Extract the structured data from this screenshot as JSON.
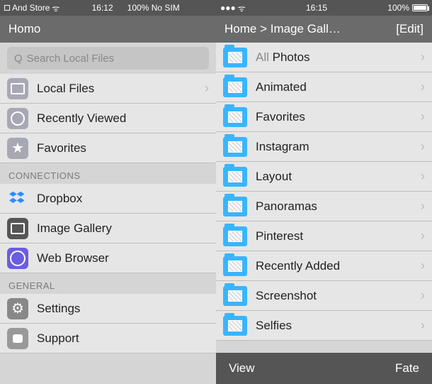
{
  "left": {
    "status": {
      "back_icon": "▢",
      "carrier": "And Store",
      "time": "16:12",
      "center": "100% No SIM"
    },
    "header": {
      "title": "Homo"
    },
    "search": {
      "placeholder": "Search Local Files"
    },
    "items": [
      {
        "label": "Local Files"
      },
      {
        "label": "Recently Viewed"
      },
      {
        "label": "Favorites"
      }
    ],
    "section_connections": "CONNECTIONS",
    "connections": [
      {
        "label": "Dropbox"
      },
      {
        "label": "Image Gallery"
      },
      {
        "label": "Web Browser"
      }
    ],
    "section_general": "GENERAL",
    "general": [
      {
        "label": "Settings"
      },
      {
        "label": "Support"
      }
    ]
  },
  "right": {
    "status": {
      "time": "16:15",
      "battery": "100%"
    },
    "header": {
      "breadcrumb": "Home > Image Gall…",
      "edit": "[Edit]"
    },
    "folders": [
      {
        "prefix": "All ",
        "label": "Photos"
      },
      {
        "label": "Animated"
      },
      {
        "label": "Favorites"
      },
      {
        "label": "Instagram"
      },
      {
        "label": "Layout"
      },
      {
        "label": "Panoramas"
      },
      {
        "label": "Pinterest"
      },
      {
        "label": "Recently Added"
      },
      {
        "label": "Screenshot"
      },
      {
        "label": "Selfies"
      }
    ],
    "toolbar": {
      "view": "View",
      "fate": "Fate"
    }
  }
}
